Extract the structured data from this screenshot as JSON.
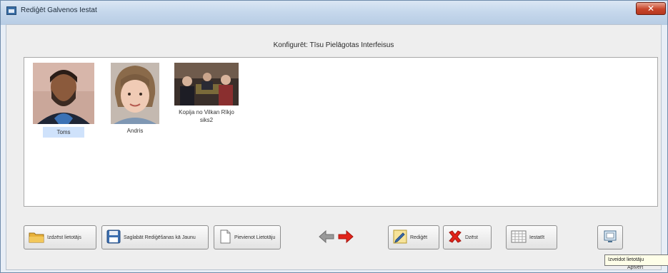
{
  "window": {
    "title": "Rediģēt Galvenos Iestat",
    "close_symbol": "✕"
  },
  "heading": "Konfigurēt: Tīsu Pielāgotas Interfeisus",
  "profiles": [
    {
      "label": "Toms",
      "selected": true,
      "icon": "user-man-photo"
    },
    {
      "label": "Andris",
      "selected": false,
      "icon": "user-child-photo"
    },
    {
      "label": "Kopija no Vilkan Rīkjo siks2",
      "selected": false,
      "icon": "meeting-photo"
    }
  ],
  "toolbar": {
    "open_label": "Izdzēst lietotājs",
    "save_label": "Saglabāt Rediģēšanas kā Jaunu",
    "new_label": "Pievienot Lietotāju",
    "edit_label": "Rediģēt",
    "delete_label": "Dzēst",
    "settings_label": "Iestatīt"
  },
  "tooltip": "Izveidot lietotāju",
  "under_tooltip": "Aptvert",
  "colors": {
    "arrow_left": "#9a9a9a",
    "arrow_right": "#e2231a",
    "delete_x": "#e2231a",
    "folder": "#e8b13a",
    "save_blue": "#3c6fb0"
  }
}
